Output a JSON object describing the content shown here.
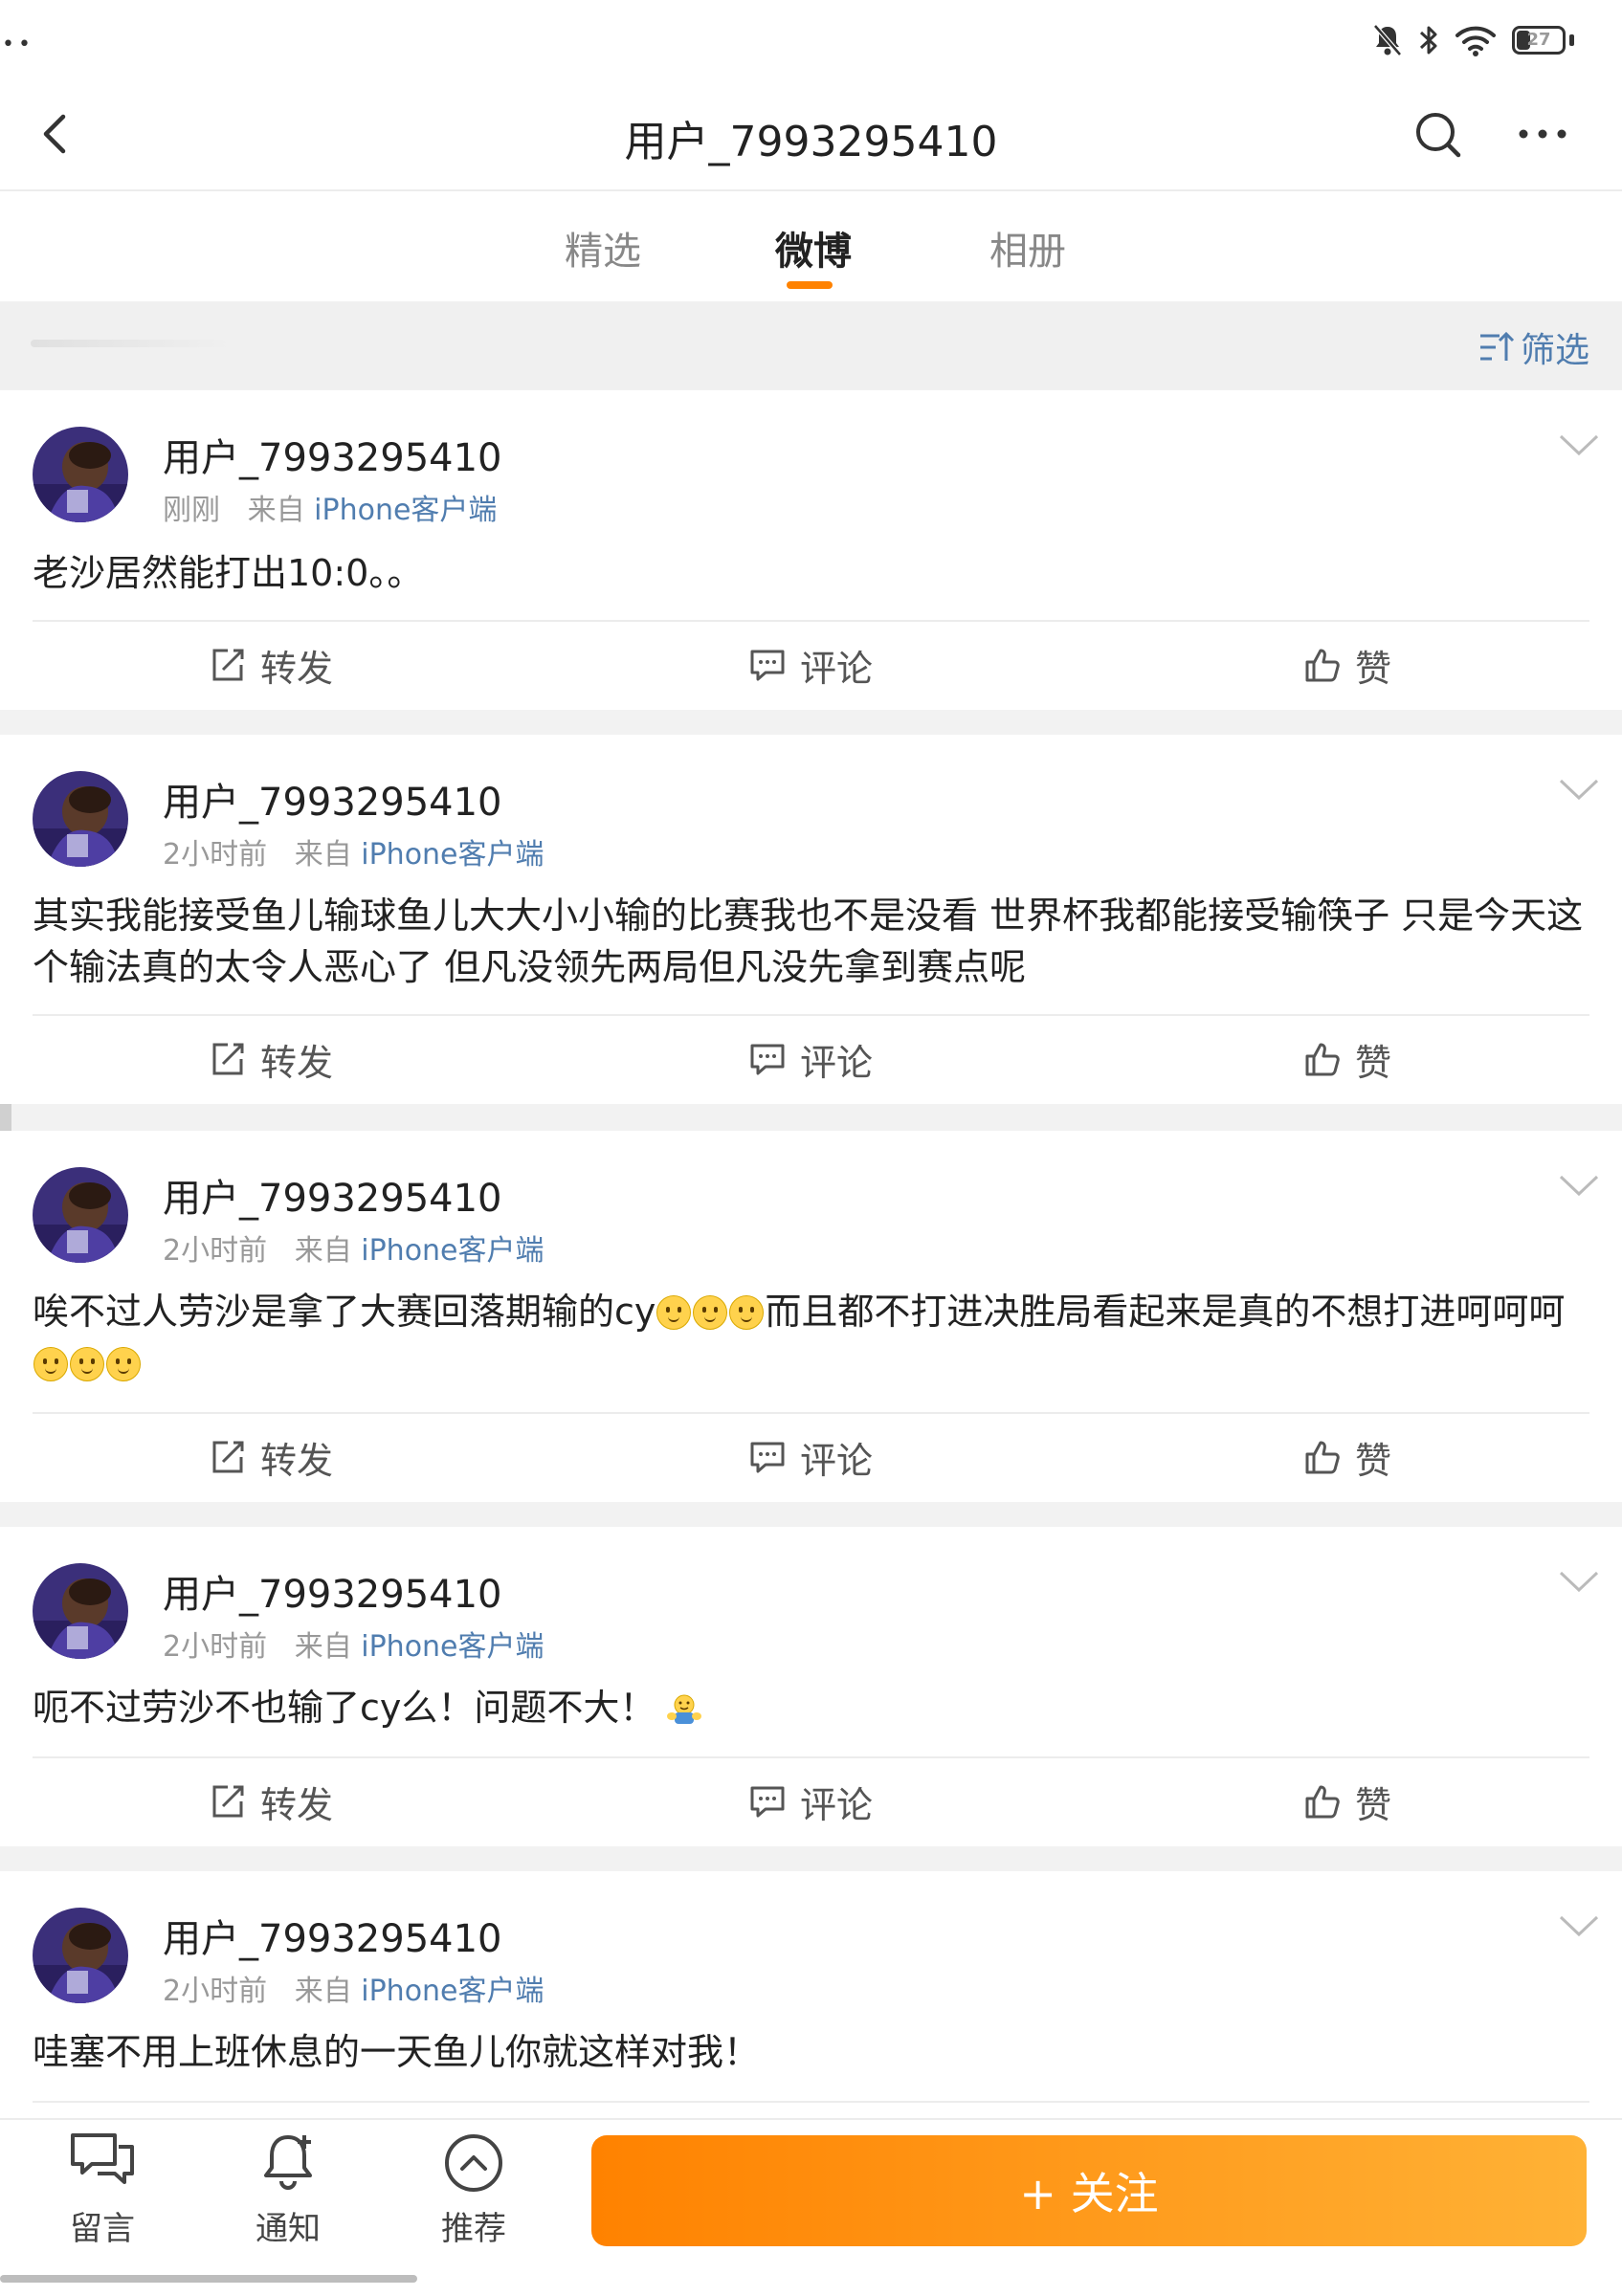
{
  "status_bar": {
    "battery": "27",
    "icons": [
      "bell-off-icon",
      "bluetooth-icon",
      "wifi-icon",
      "battery-icon"
    ]
  },
  "header": {
    "title": "用户_7993295410",
    "icons": [
      "back-icon",
      "search-icon",
      "more-icon"
    ]
  },
  "tabs": [
    {
      "label": "精选",
      "active": false
    },
    {
      "label": "微博",
      "active": true
    },
    {
      "label": "相册",
      "active": false
    }
  ],
  "filter": {
    "label": "筛选",
    "icon": "filter-sort-icon"
  },
  "posts": [
    {
      "username": "用户_7993295410",
      "time": "刚刚",
      "from": "来自",
      "source": "iPhone客户端",
      "text": "老沙居然能打出10:0。。",
      "emojis": "",
      "hug": false
    },
    {
      "username": "用户_7993295410",
      "time": "2小时前",
      "from": "来自",
      "source": "iPhone客户端",
      "text": "其实我能接受鱼儿输球鱼儿大大小小输的比赛我也不是没看 世界杯我都能接受输筷子 只是今天这个输法真的太令人恶心了 但凡没领先两局但凡没先拿到赛点呢",
      "emojis": "",
      "hug": false
    },
    {
      "username": "用户_7993295410",
      "time": "2小时前",
      "from": "来自",
      "source": "iPhone客户端",
      "text_parts": [
        "唉不过人劳沙是拿了大赛回落期输的cy",
        "而且都不打进决胜局看起来是真的不想打进呵呵呵"
      ],
      "hug": false
    },
    {
      "username": "用户_7993295410",
      "time": "2小时前",
      "from": "来自",
      "source": "iPhone客户端",
      "text": "呃不过劳沙不也输了cy么！问题不大！",
      "emojis": "",
      "hug": true
    },
    {
      "username": "用户_7993295410",
      "time": "2小时前",
      "from": "来自",
      "source": "iPhone客户端",
      "text": "哇塞不用上班休息的一天鱼儿你就这样对我！",
      "emojis": "",
      "hug": false
    }
  ],
  "post_actions": {
    "repost": "转发",
    "comment": "评论",
    "like": "赞"
  },
  "bottom_bar": {
    "message": "留言",
    "notify": "通知",
    "recommend": "推荐",
    "follow": "+ 关注"
  },
  "colors": {
    "accent": "#ff8200",
    "link": "#507daf"
  }
}
